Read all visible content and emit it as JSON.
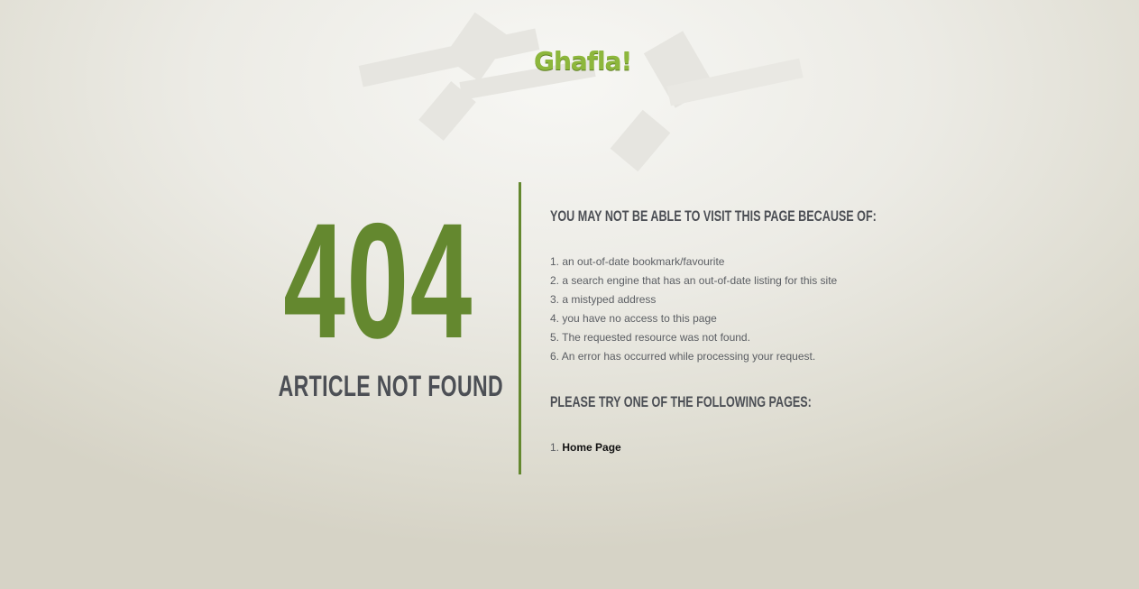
{
  "logo": {
    "text": "Ghafla!",
    "color": "#8db73c"
  },
  "error": {
    "code": "404",
    "message": "ARTICLE NOT FOUND",
    "accent_color": "#64882f"
  },
  "reasons": {
    "heading": "YOU MAY NOT BE ABLE TO VISIT THIS PAGE BECAUSE OF:",
    "items": [
      {
        "num": "1.",
        "text": "an out-of-date bookmark/favourite"
      },
      {
        "num": "2.",
        "text": "a search engine that has an out-of-date listing for this site"
      },
      {
        "num": "3.",
        "text": "a mistyped address"
      },
      {
        "num": "4.",
        "text": "you have no access to this page"
      },
      {
        "num": "5.",
        "text": "The requested resource was not found."
      },
      {
        "num": "6.",
        "text": "An error has occurred while processing your request."
      }
    ]
  },
  "suggestions": {
    "heading": "PLEASE TRY ONE OF THE FOLLOWING PAGES:",
    "items": [
      {
        "num": "1.",
        "label": "Home Page"
      }
    ]
  }
}
